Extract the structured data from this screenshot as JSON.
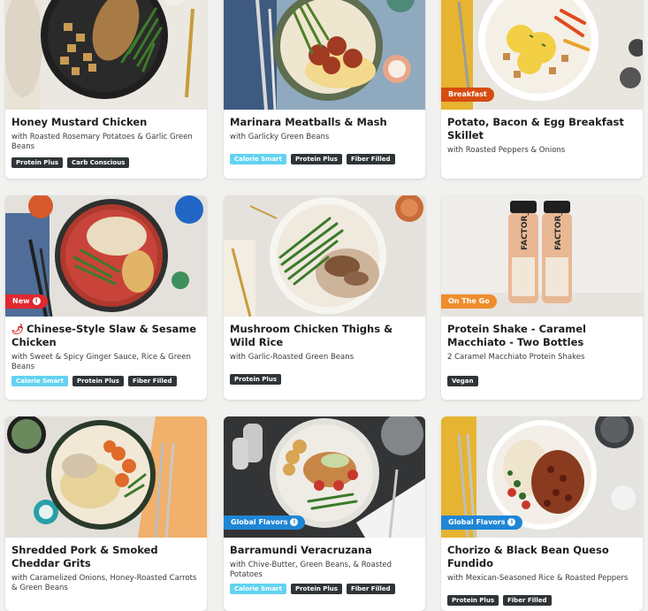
{
  "colors": {
    "breakfast_badge": "#d64c11",
    "new_badge": "#e0282f",
    "on_the_go_badge": "#ef8d2c",
    "global_flavors_badge": "#1f86d6",
    "calorie_smart_tag": "#62d3f0",
    "dark_tag": "#2f3437"
  },
  "meals": [
    {
      "title": "Honey Mustard Chicken",
      "subtitle": "with Roasted Rosemary Potatoes & Garlic Green Beans",
      "badge": null,
      "tags": [
        {
          "label": "Protein Plus"
        },
        {
          "label": "Carb Conscious"
        }
      ],
      "image_icon": "plated-meal-image"
    },
    {
      "title": "Marinara Meatballs & Mash",
      "subtitle": "with Garlicky Green Beans",
      "badge": null,
      "tags": [
        {
          "label": "Calorie Smart"
        },
        {
          "label": "Protein Plus"
        },
        {
          "label": "Fiber Filled"
        }
      ],
      "image_icon": "plated-meal-image"
    },
    {
      "title": "Potato, Bacon & Egg Breakfast Skillet",
      "subtitle": "with Roasted Peppers & Onions",
      "badge": {
        "label": "Breakfast"
      },
      "tags": [],
      "image_icon": "plated-meal-image"
    },
    {
      "title": "Chinese-Style Slaw & Sesame Chicken",
      "subtitle": "with Sweet & Spicy Ginger Sauce, Rice & Green Beans",
      "badge": {
        "label": "New"
      },
      "tags": [
        {
          "label": "Calorie Smart"
        },
        {
          "label": "Protein Plus"
        },
        {
          "label": "Fiber Filled"
        }
      ],
      "image_icon": "plated-meal-image",
      "spicy_icon": "chili-pepper-icon"
    },
    {
      "title": "Mushroom Chicken Thighs & Wild Rice",
      "subtitle": "with Garlic-Roasted Green Beans",
      "badge": null,
      "tags": [
        {
          "label": "Protein Plus"
        }
      ],
      "image_icon": "plated-meal-image"
    },
    {
      "title": "Protein Shake - Caramel Macchiato - Two Bottles",
      "subtitle": "2 Caramel Macchiato Protein Shakes",
      "badge": {
        "label": "On The Go"
      },
      "tags": [
        {
          "label": "Vegan"
        }
      ],
      "image_icon": "protein-shake-bottles-image",
      "bottle_text": "FACTOR_"
    },
    {
      "title": "Shredded Pork & Smoked Cheddar Grits",
      "subtitle": "with Caramelized Onions, Honey-Roasted Carrots & Green Beans",
      "badge": null,
      "tags": [],
      "image_icon": "plated-meal-image"
    },
    {
      "title": "Barramundi Veracruzana",
      "subtitle": "with Chive-Butter, Green Beans, & Roasted Potatoes",
      "badge": {
        "label": "Global Flavors"
      },
      "tags": [
        {
          "label": "Calorie Smart"
        },
        {
          "label": "Protein Plus"
        },
        {
          "label": "Fiber Filled"
        }
      ],
      "image_icon": "plated-meal-image"
    },
    {
      "title": "Chorizo & Black Bean Queso Fundido",
      "subtitle": "with Mexican-Seasoned Rice & Roasted Peppers",
      "badge": {
        "label": "Global Flavors"
      },
      "tags": [
        {
          "label": "Protein Plus"
        },
        {
          "label": "Fiber Filled"
        }
      ],
      "image_icon": "plated-meal-image"
    }
  ]
}
